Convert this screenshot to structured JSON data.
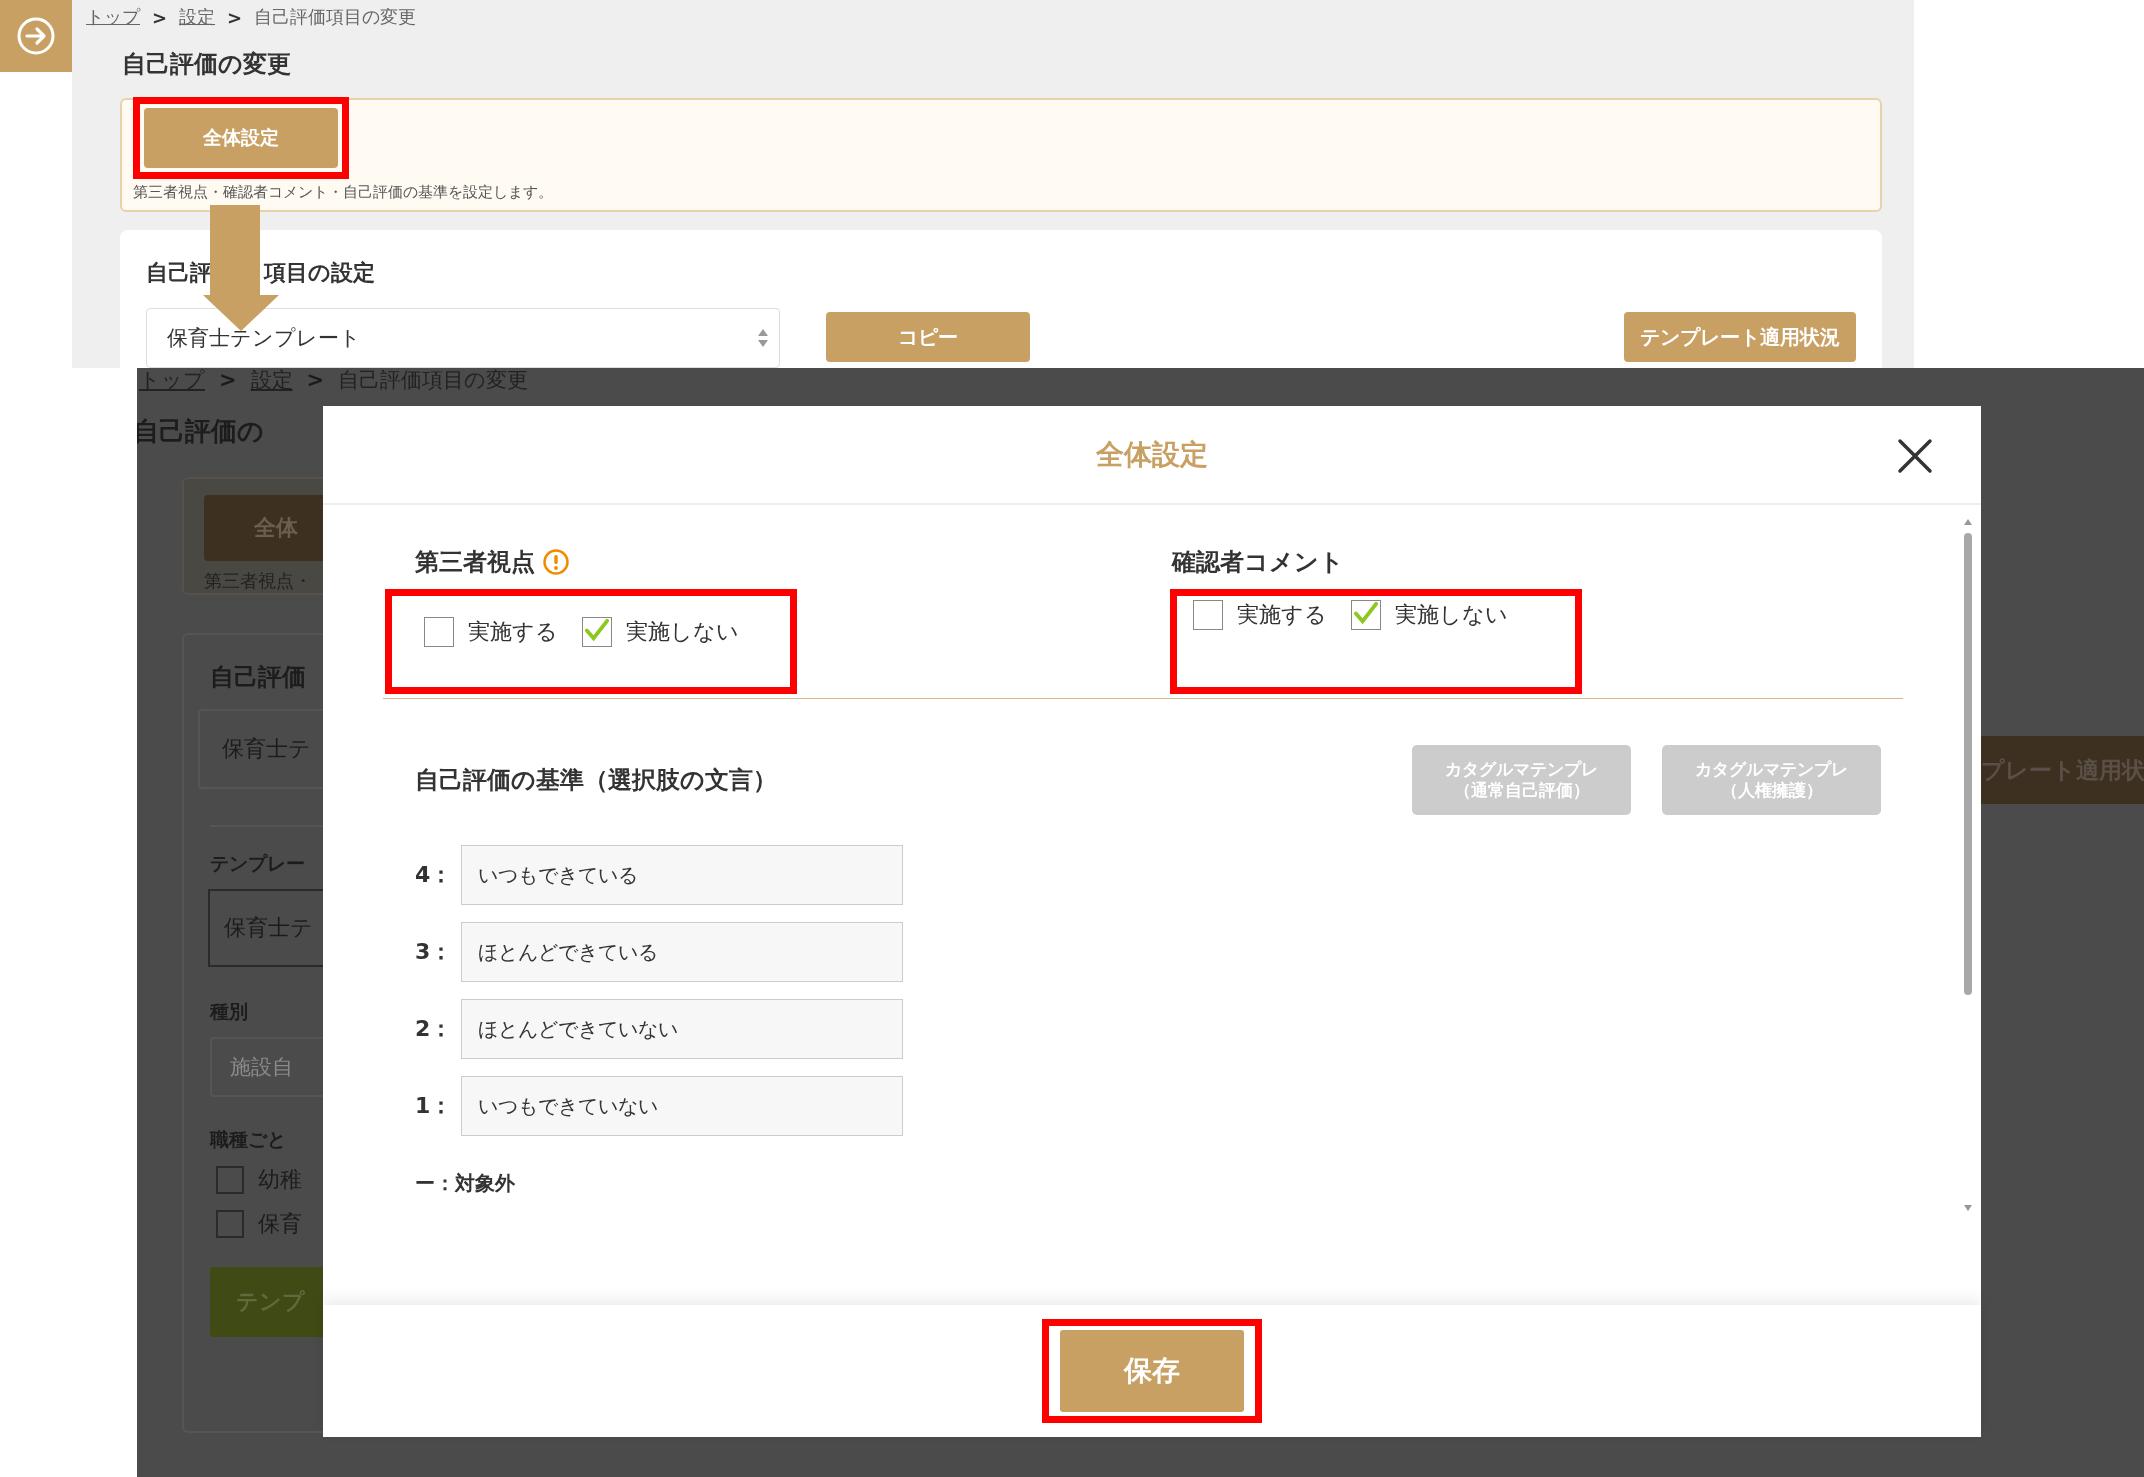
{
  "top_page": {
    "breadcrumb": [
      {
        "label": "トップ",
        "link": true
      },
      {
        "label": "設定",
        "link": true
      },
      {
        "label": "自己評価項目の変更",
        "link": false
      }
    ],
    "separator": ">",
    "title": "自己評価の変更",
    "notice": {
      "button": {
        "label": "全体設定",
        "highlighted": true
      },
      "description": "第三者視点・確認者コメント・自己評価の基準を設定します。"
    },
    "items_card": {
      "title_parts": [
        "自己評",
        "項目の設定"
      ],
      "select_value": "保育士テンプレート",
      "buttons": [
        "コピー",
        "テンプレート適用状況"
      ]
    }
  },
  "background_page": {
    "breadcrumb": [
      {
        "label": "トップ",
        "link": true
      },
      {
        "label": "設定",
        "link": true
      },
      {
        "label": "自己評価項目の変更",
        "link": false
      }
    ],
    "separator": ">",
    "title": "自己評価の",
    "notice_button": "全体",
    "notice_text": "第三者視点・",
    "card_title": "自己評価",
    "select_value": "保育士テ",
    "template_label": "テンプレー",
    "template_value": "保育士テ",
    "type_label": "種別",
    "type_placeholder": "施設自",
    "job_label": "職種ごと",
    "job_options": [
      {
        "label": "幼稚",
        "checked": false
      },
      {
        "label": "保育",
        "checked": false
      }
    ],
    "apply_button": "テンプ",
    "status_button": "プレート適用状"
  },
  "dialog": {
    "title": "全体設定",
    "sections": [
      {
        "title": "第三者視点",
        "warning": true,
        "highlighted": true,
        "options": [
          {
            "label": "実施する",
            "checked": false
          },
          {
            "label": "実施しない",
            "checked": true
          }
        ]
      },
      {
        "title": "確認者コメント",
        "warning": false,
        "highlighted": true,
        "options": [
          {
            "label": "実施する",
            "checked": false
          },
          {
            "label": "実施しない",
            "checked": true
          }
        ]
      }
    ],
    "criteria": {
      "title": "自己評価の基準（選択肢の文言）",
      "template_buttons": [
        {
          "label_lines": [
            "カタグルマテンプレ",
            "（通常自己評価）"
          ],
          "disabled": true
        },
        {
          "label_lines": [
            "カタグルマテンプレ",
            "（人権擁護）"
          ],
          "disabled": true
        }
      ],
      "levels": [
        {
          "label": "4：",
          "value": "いつもできている"
        },
        {
          "label": "3：",
          "value": "ほとんどできている"
        },
        {
          "label": "2：",
          "value": "ほとんどできていない"
        },
        {
          "label": "1：",
          "value": "いつもできていない"
        }
      ],
      "excluded": "ー：対象外"
    },
    "save_button": {
      "label": "保存",
      "highlighted": true
    }
  }
}
